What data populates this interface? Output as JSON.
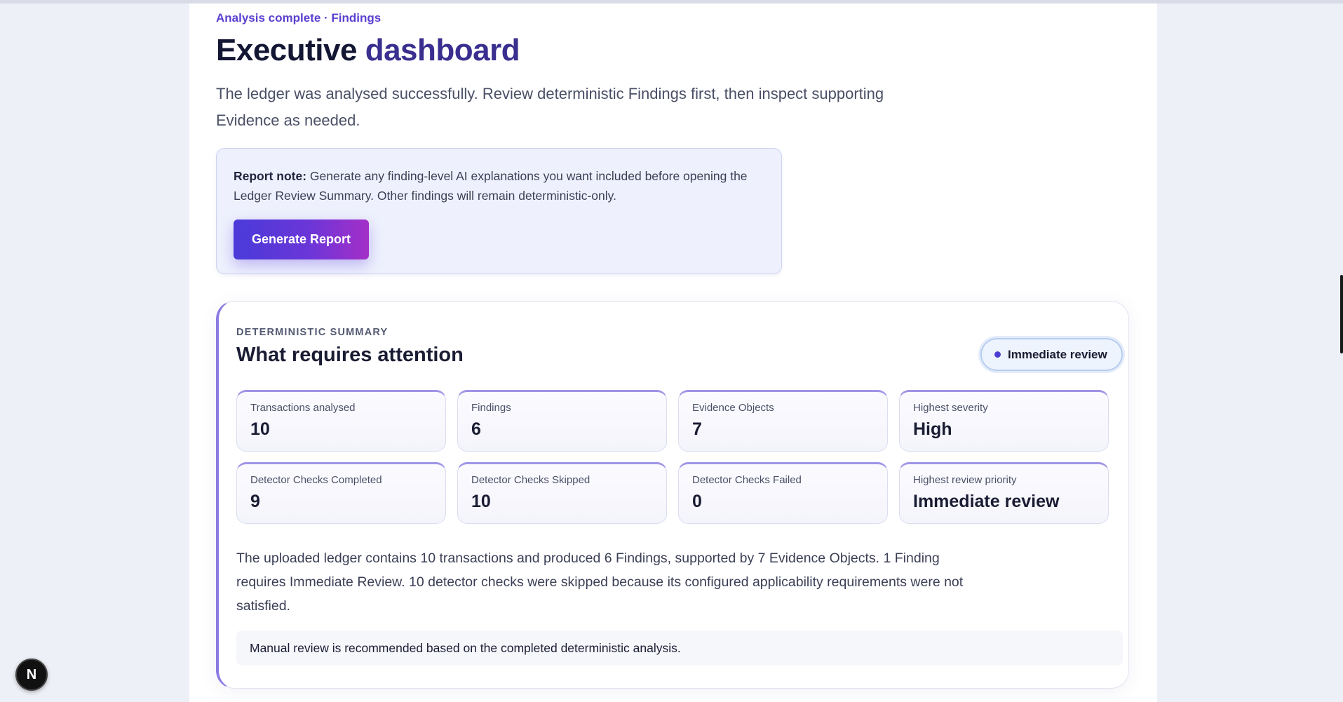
{
  "header": {
    "kicker": "Analysis complete · Findings",
    "title_part1": "Executive",
    "title_part2": "dashboard",
    "lead": "The ledger was analysed successfully. Review deterministic Findings first, then inspect supporting Evidence as needed."
  },
  "report_note": {
    "label": "Report note:",
    "text": "Generate any finding-level AI explanations you want included before opening the Ledger Review Summary. Other findings will remain deterministic-only.",
    "button_label": "Generate Report"
  },
  "summary": {
    "eyebrow": "DETERMINISTIC SUMMARY",
    "title": "What requires attention",
    "badge_label": "Immediate review",
    "stats": [
      {
        "label": "Transactions analysed",
        "value": "10"
      },
      {
        "label": "Findings",
        "value": "6"
      },
      {
        "label": "Evidence Objects",
        "value": "7"
      },
      {
        "label": "Highest severity",
        "value": "High"
      },
      {
        "label": "Detector Checks Completed",
        "value": "9"
      },
      {
        "label": "Detector Checks Skipped",
        "value": "10"
      },
      {
        "label": "Detector Checks Failed",
        "value": "0"
      },
      {
        "label": "Highest review priority",
        "value": "Immediate review"
      }
    ],
    "narrative": "The uploaded ledger contains 10 transactions and produced 6 Findings, supported by 7 Evidence Objects. 1 Finding requires Immediate Review. 10 detector checks were skipped because its configured applicability requirements were not satisfied.",
    "callout": "Manual review is recommended based on the completed deterministic analysis."
  },
  "devtools": {
    "badge_letter": "N"
  }
}
